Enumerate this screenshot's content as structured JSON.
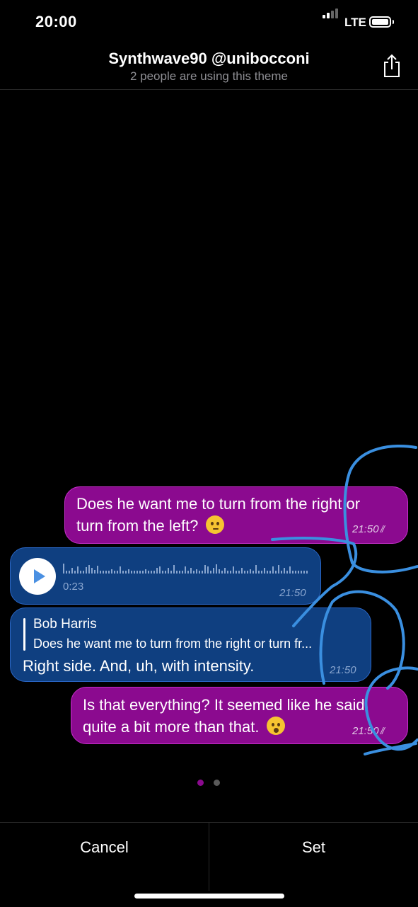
{
  "status_bar": {
    "time": "20:00",
    "network": "LTE"
  },
  "header": {
    "title": "Synthwave90 @unibocconi",
    "subtitle": "2 people are using this theme",
    "share_icon": "share-icon"
  },
  "messages": [
    {
      "direction": "outgoing",
      "text_line1": "Does he want me to turn from the right or",
      "text_line2": "turn from the left?",
      "time": "21:50",
      "emoji": "thinking-face"
    },
    {
      "direction": "incoming",
      "type": "voice",
      "duration": "0:23",
      "time": "21:50"
    },
    {
      "direction": "incoming",
      "reply_to_name": "Bob Harris",
      "reply_to_text": "Does he want me to turn from the right or turn fr...",
      "text": "Right side. And, uh, with intensity.",
      "time": "21:50"
    },
    {
      "direction": "outgoing",
      "text_line1": "Is that everything? It seemed like he said",
      "text_line2": "quite a bit more than that.",
      "time": "21:50",
      "emoji": "hushed-face"
    }
  ],
  "pager": {
    "active_color": "#8b0a8f",
    "inactive_color": "#5a5a5a"
  },
  "footer": {
    "cancel_label": "Cancel",
    "set_label": "Set"
  },
  "colors": {
    "outgoing_bubble": "#8b0a8f",
    "incoming_bubble": "#0f3f80",
    "scribble": "#3a8fe0"
  }
}
